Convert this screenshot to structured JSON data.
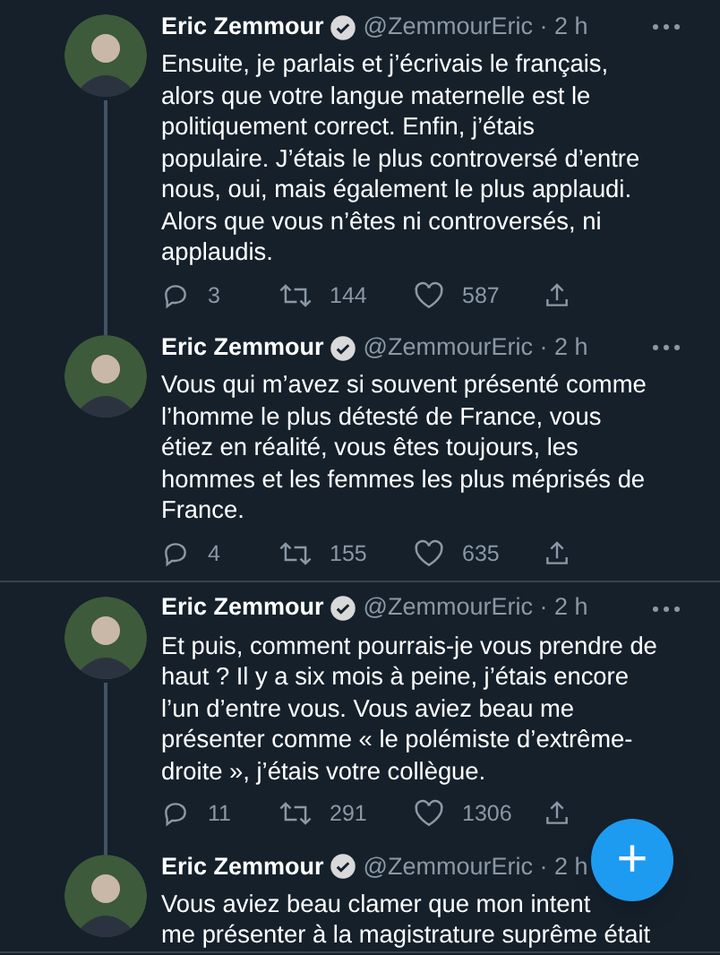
{
  "tweets": [
    {
      "name": "Eric Zemmour",
      "verified": true,
      "handle_time": "@ZemmourEric · 2 h",
      "more_button": true,
      "thread_above": false,
      "thread_below": true,
      "lines": [
        "Ensuite, je parlais et j’écrivais le français,",
        "alors que votre langue maternelle est le",
        "politiquement correct. Enfin, j’étais",
        "populaire. J’étais le plus controversé d’entre",
        "nous, oui, mais également le plus applaudi.",
        "Alors que vous n’êtes ni controversés, ni",
        "applaudis."
      ],
      "replies": "3",
      "retweets": "144",
      "likes": "587"
    },
    {
      "name": "Eric Zemmour",
      "verified": true,
      "handle_time": "@ZemmourEric · 2 h",
      "more_button": true,
      "thread_above": true,
      "thread_below": false,
      "lines": [
        "Vous qui m’avez si souvent présenté comme",
        "l’homme le plus détesté de France, vous",
        "étiez en réalité, vous êtes toujours, les",
        "hommes et les femmes les plus méprisés de",
        "France."
      ],
      "replies": "4",
      "retweets": "155",
      "likes": "635"
    },
    {
      "name": "Eric Zemmour",
      "verified": true,
      "handle_time": "@ZemmourEric · 2 h",
      "more_button": true,
      "thread_above": false,
      "thread_below": true,
      "lines": [
        "Et puis, comment pourrais-je vous prendre de",
        "haut ? Il y a six mois à peine, j’étais encore",
        "l’un d’entre vous. Vous aviez beau me",
        "présenter comme « le polémiste d’extrême-",
        "droite », j’étais votre collègue."
      ],
      "replies": "11",
      "retweets": "291",
      "likes": "1306"
    },
    {
      "name": "Eric Zemmour",
      "verified": true,
      "handle_time": "@ZemmourEric · 2 h",
      "thread_above": true,
      "thread_below": false,
      "lines": [
        "Vous aviez beau clamer que mon intent",
        "me présenter à la magistrature suprême était"
      ]
    }
  ],
  "compose_button": {
    "label": "+"
  }
}
